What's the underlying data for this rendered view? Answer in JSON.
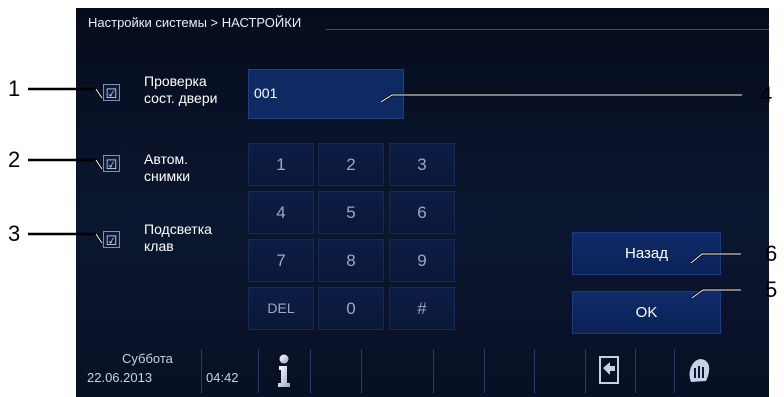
{
  "breadcrumb": "Настройки системы > НАСТРОЙКИ",
  "options": [
    {
      "line1": "Проверка",
      "line2": "сост. двери",
      "checked": true
    },
    {
      "line1": "Автом.",
      "line2": "снимки",
      "checked": true
    },
    {
      "line1": "Подсветка",
      "line2": "клав",
      "checked": true
    }
  ],
  "check_glyph": "☑",
  "code_value": "001",
  "keypad": [
    "1",
    "2",
    "3",
    "4",
    "5",
    "6",
    "7",
    "8",
    "9",
    "DEL",
    "0",
    "#"
  ],
  "back_label": "Назад",
  "ok_label": "OK",
  "status": {
    "day": "Суббота",
    "date": "22.06.2013",
    "time": "04:42"
  },
  "icons": [
    "info-icon",
    "exit-icon",
    "hand-touch-icon"
  ],
  "callouts": [
    "1",
    "2",
    "3",
    "4",
    "5",
    "6"
  ],
  "colors": {
    "screen_bg": "#081024",
    "field_bg": "#0d2a62",
    "key_text": "#9aa6c8",
    "text": "#ffffff"
  }
}
